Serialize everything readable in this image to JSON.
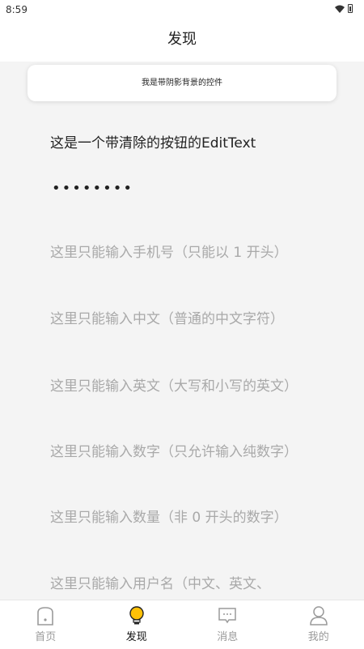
{
  "status_bar": {
    "time": "8:59"
  },
  "header": {
    "title": "发现"
  },
  "shadow_card": {
    "text": "我是带阴影背景的控件"
  },
  "fields": {
    "clear_edit_text": "这是一个带清除的按钮的EditText",
    "password_mask": "••••••••"
  },
  "input_hints": [
    "这里只能输入手机号（只能以 1 开头）",
    "这里只能输入中文（普通的中文字符）",
    "这里只能输入英文（大写和小写的英文）",
    "这里只能输入数字（只允许输入纯数字）",
    "这里只能输入数量（非 0 开头的数字）",
    "这里只能输入用户名（中文、英文、"
  ],
  "bottom_nav": {
    "items": [
      {
        "label": "首页",
        "icon": "home-icon"
      },
      {
        "label": "发现",
        "icon": "lightbulb-icon"
      },
      {
        "label": "消息",
        "icon": "message-icon"
      },
      {
        "label": "我的",
        "icon": "person-icon"
      }
    ],
    "active_index": 1,
    "active_icon_color": "#ffc107",
    "inactive_color": "#9a9a9a"
  }
}
